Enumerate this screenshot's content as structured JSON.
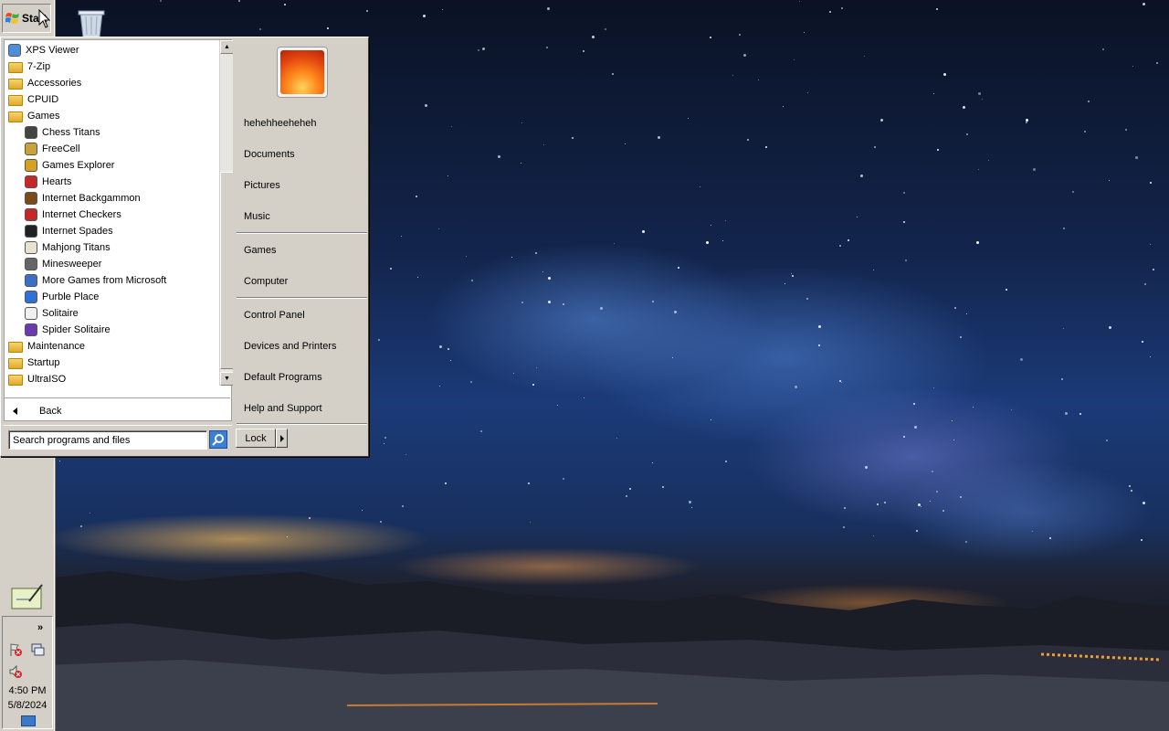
{
  "taskbar": {
    "start_label": "Start",
    "clock_time": "4:50 PM",
    "clock_date": "5/8/2024",
    "tray_chevron": "»"
  },
  "start_menu": {
    "programs": [
      {
        "label": "XPS Viewer",
        "icon": "xps-viewer-icon",
        "indent": 0
      },
      {
        "label": "7-Zip",
        "icon": "folder-icon",
        "indent": 0
      },
      {
        "label": "Accessories",
        "icon": "folder-icon",
        "indent": 0
      },
      {
        "label": "CPUID",
        "icon": "folder-icon",
        "indent": 0
      },
      {
        "label": "Games",
        "icon": "folder-icon",
        "indent": 0
      },
      {
        "label": "Chess Titans",
        "icon": "chess-icon",
        "indent": 1
      },
      {
        "label": "FreeCell",
        "icon": "freecell-icon",
        "indent": 1
      },
      {
        "label": "Games Explorer",
        "icon": "games-explorer-icon",
        "indent": 1
      },
      {
        "label": "Hearts",
        "icon": "hearts-icon",
        "indent": 1
      },
      {
        "label": "Internet Backgammon",
        "icon": "backgammon-icon",
        "indent": 1
      },
      {
        "label": "Internet Checkers",
        "icon": "checkers-icon",
        "indent": 1
      },
      {
        "label": "Internet Spades",
        "icon": "spades-icon",
        "indent": 1
      },
      {
        "label": "Mahjong Titans",
        "icon": "mahjong-icon",
        "indent": 1
      },
      {
        "label": "Minesweeper",
        "icon": "minesweeper-icon",
        "indent": 1
      },
      {
        "label": "More Games from Microsoft",
        "icon": "more-games-icon",
        "indent": 1
      },
      {
        "label": "Purble Place",
        "icon": "purble-place-icon",
        "indent": 1
      },
      {
        "label": "Solitaire",
        "icon": "solitaire-icon",
        "indent": 1
      },
      {
        "label": "Spider Solitaire",
        "icon": "spider-solitaire-icon",
        "indent": 1
      },
      {
        "label": "Maintenance",
        "icon": "folder-icon",
        "indent": 0
      },
      {
        "label": "Startup",
        "icon": "folder-icon",
        "indent": 0
      },
      {
        "label": "UltraISO",
        "icon": "folder-icon",
        "indent": 0
      }
    ],
    "back_label": "Back",
    "search_placeholder": "Search programs and files",
    "user_name": "hehehheeheheh",
    "right_group_1": [
      "Documents",
      "Pictures",
      "Music"
    ],
    "right_group_2": [
      "Games",
      "Computer"
    ],
    "right_group_3": [
      "Control Panel",
      "Devices and Printers",
      "Default Programs",
      "Help and Support"
    ],
    "lock_label": "Lock"
  },
  "colors": {
    "chrome": "#d4d0c8",
    "folder": "#e0a92c",
    "search_button": "#3c7fd6"
  }
}
